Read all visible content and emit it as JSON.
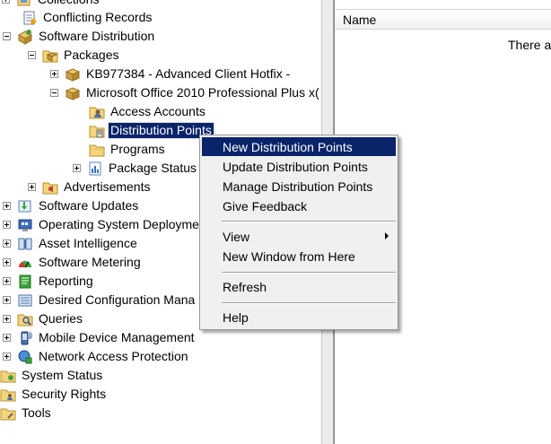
{
  "tree": {
    "items": [
      {
        "label": "Collections",
        "icon": "collections-icon"
      },
      {
        "label": "Conflicting Records",
        "icon": "conflict-icon"
      },
      {
        "label": "Software Distribution",
        "icon": "software-distribution-icon"
      },
      {
        "label": "Packages",
        "icon": "packages-folder-icon"
      },
      {
        "label": "KB977384 - Advanced Client Hotfix -",
        "icon": "package-icon"
      },
      {
        "label": "Microsoft Office 2010 Professional Plus x(",
        "icon": "package-icon"
      },
      {
        "label": "Access Accounts",
        "icon": "access-accounts-icon"
      },
      {
        "label": "Distribution Points",
        "icon": "distribution-points-icon"
      },
      {
        "label": "Programs",
        "icon": "folder-icon"
      },
      {
        "label": "Package Status",
        "icon": "package-status-icon"
      },
      {
        "label": "Advertisements",
        "icon": "advertisements-icon"
      },
      {
        "label": "Software Updates",
        "icon": "software-updates-icon"
      },
      {
        "label": "Operating System Deployme",
        "icon": "os-deployment-icon"
      },
      {
        "label": "Asset Intelligence",
        "icon": "asset-intelligence-icon"
      },
      {
        "label": "Software Metering",
        "icon": "software-metering-icon"
      },
      {
        "label": "Reporting",
        "icon": "reporting-icon"
      },
      {
        "label": "Desired Configuration Mana",
        "icon": "desired-configuration-icon"
      },
      {
        "label": "Queries",
        "icon": "queries-icon"
      },
      {
        "label": "Mobile Device Management",
        "icon": "mobile-device-icon"
      },
      {
        "label": "Network Access Protection",
        "icon": "network-access-icon"
      },
      {
        "label": "System Status",
        "icon": "system-status-icon"
      },
      {
        "label": "Security Rights",
        "icon": "security-rights-icon"
      },
      {
        "label": "Tools",
        "icon": "tools-icon"
      }
    ]
  },
  "list_pane": {
    "column_header": "Name",
    "empty_message": "There a"
  },
  "context_menu": {
    "items": [
      {
        "label": "New Distribution Points"
      },
      {
        "label": "Update Distribution Points"
      },
      {
        "label": "Manage Distribution Points"
      },
      {
        "label": "Give Feedback"
      },
      {
        "label": "View"
      },
      {
        "label": "New Window from Here"
      },
      {
        "label": "Refresh"
      },
      {
        "label": "Help"
      }
    ]
  },
  "colors": {
    "selection": "#0a246a",
    "menu_background": "#f0f0f0"
  }
}
